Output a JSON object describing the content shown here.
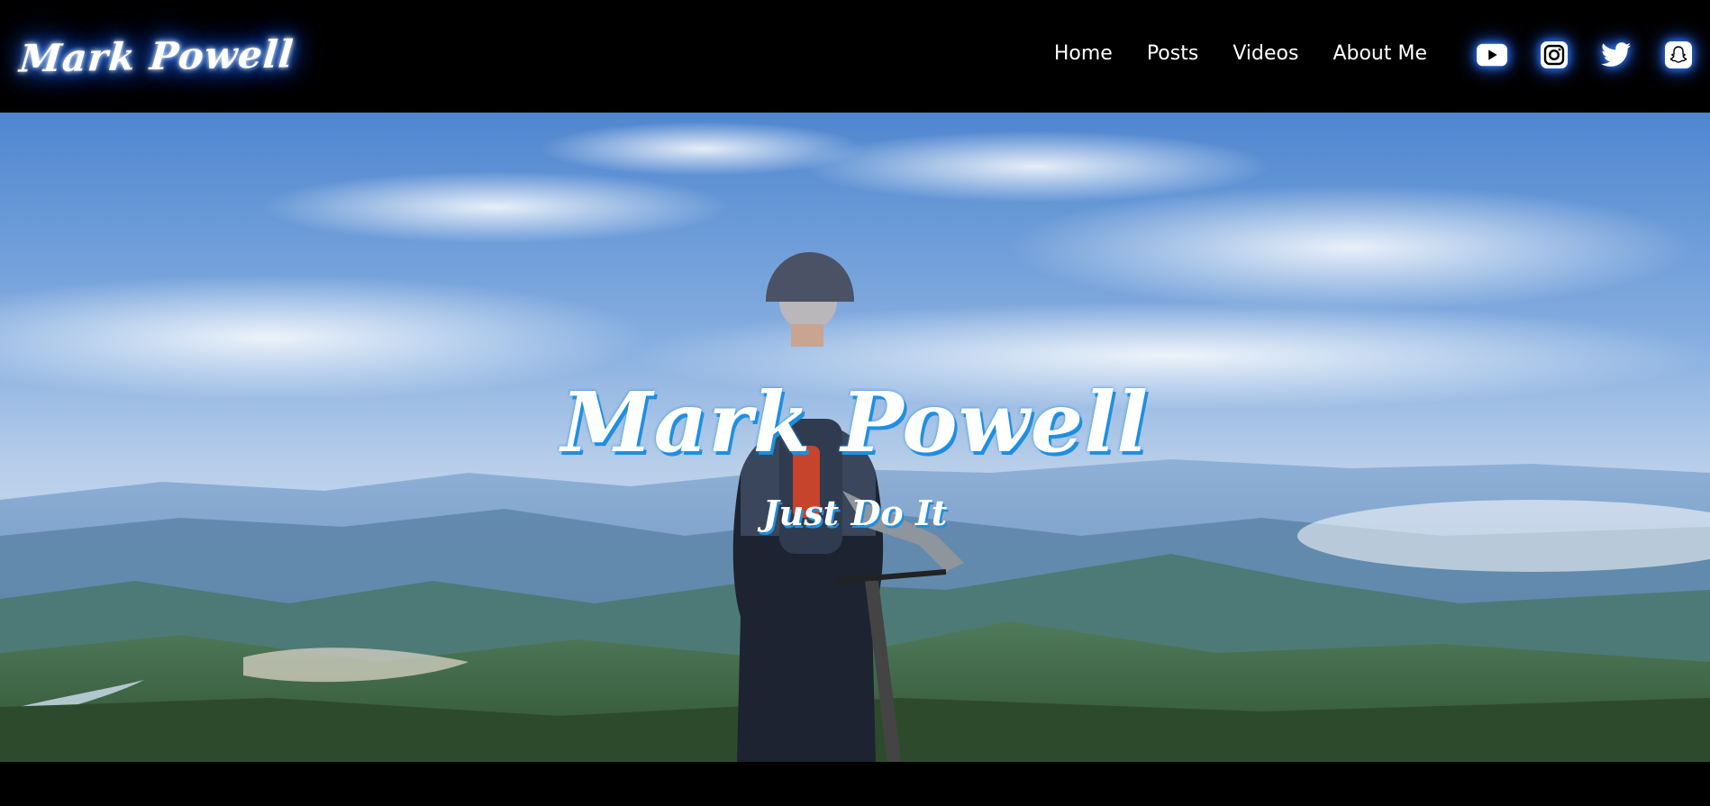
{
  "header": {
    "logo_text": "Mark Powell",
    "nav": [
      {
        "label": "Home"
      },
      {
        "label": "Posts"
      },
      {
        "label": "Videos"
      },
      {
        "label": "About Me"
      }
    ],
    "social_icons": [
      "youtube-icon",
      "instagram-icon",
      "twitter-icon",
      "snapchat-icon"
    ]
  },
  "hero": {
    "title": "Mark Powell",
    "subtitle": "Just Do It"
  },
  "colors": {
    "background": "#000000",
    "glow": "#1f5cff",
    "accent": "#1e8fe0",
    "text": "#ffffff"
  }
}
